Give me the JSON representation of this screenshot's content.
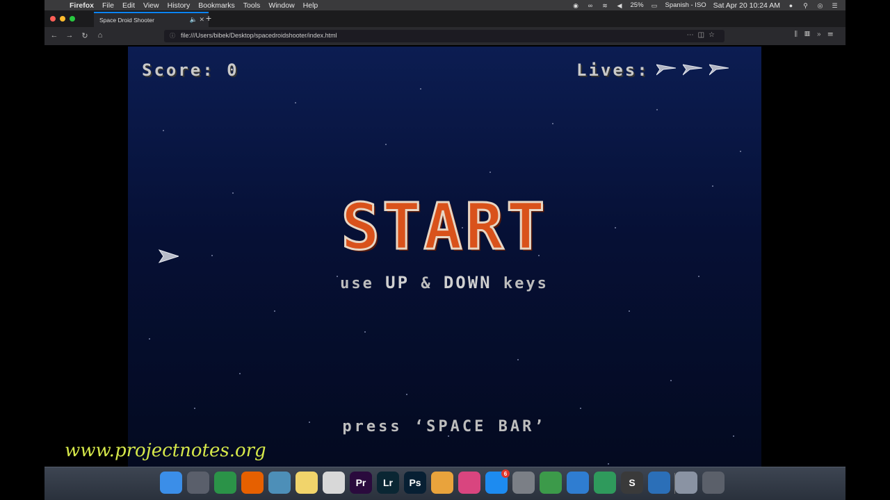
{
  "menubar": {
    "app_name": "Firefox",
    "menus": [
      "File",
      "Edit",
      "View",
      "History",
      "Bookmarks",
      "Tools",
      "Window",
      "Help"
    ],
    "battery": "25%",
    "input_source": "Spanish - ISO",
    "datetime": "Sat Apr 20  10:24 AM"
  },
  "browser": {
    "tab_title": "Space Droid Shooter",
    "url": "file:///Users/bibek/Desktop/spacedroidshooter/index.html"
  },
  "game": {
    "score_label": "Score:",
    "score_value": "0",
    "lives_label": "Lives:",
    "lives_count": 3,
    "start_title": "START",
    "instructions_use": "use",
    "instructions_up": "UP",
    "instructions_amp": "&",
    "instructions_down": "DOWN",
    "instructions_keys": "keys",
    "press_prefix": "press",
    "press_key": "‘SPACE BAR’"
  },
  "watermark": "www.projectnotes.org",
  "dock": {
    "apps": [
      {
        "name": "finder-icon",
        "label": "",
        "color": "#3b8ee8"
      },
      {
        "name": "launchpad-icon",
        "label": "",
        "color": "#5a5f6b"
      },
      {
        "name": "chrome-icon",
        "label": "",
        "color": "#2b9348"
      },
      {
        "name": "firefox-icon",
        "label": "",
        "color": "#e66000"
      },
      {
        "name": "preview-icon",
        "label": "",
        "color": "#4d8fb8"
      },
      {
        "name": "notes-icon",
        "label": "",
        "color": "#f1d46b"
      },
      {
        "name": "textedit-icon",
        "label": "",
        "color": "#d8d8d8"
      },
      {
        "name": "premiere-icon",
        "label": "Pr",
        "color": "#2a0a3d"
      },
      {
        "name": "lightroom-icon",
        "label": "Lr",
        "color": "#0a2633"
      },
      {
        "name": "photoshop-icon",
        "label": "Ps",
        "color": "#071f33"
      },
      {
        "name": "photos-icon",
        "label": "",
        "color": "#e9a33c"
      },
      {
        "name": "itunes-icon",
        "label": "",
        "color": "#d9457f"
      },
      {
        "name": "app-store-icon",
        "label": "",
        "color": "#1d8bf0",
        "badge": "6"
      },
      {
        "name": "system-preferences-icon",
        "label": "",
        "color": "#7b7f86"
      },
      {
        "name": "android-studio-icon",
        "label": "",
        "color": "#3c9a4a"
      },
      {
        "name": "xcode-icon",
        "label": "",
        "color": "#2f7dd1"
      },
      {
        "name": "security-icon",
        "label": "",
        "color": "#2f9a5c"
      },
      {
        "name": "sublime-text-icon",
        "label": "S",
        "color": "#3a3a3a"
      },
      {
        "name": "quicktime-icon",
        "label": "",
        "color": "#2b6fb8"
      },
      {
        "name": "finder-folder-icon",
        "label": "",
        "color": "#8a93a3"
      },
      {
        "name": "trash-icon",
        "label": "",
        "color": "#5b606a"
      }
    ]
  }
}
